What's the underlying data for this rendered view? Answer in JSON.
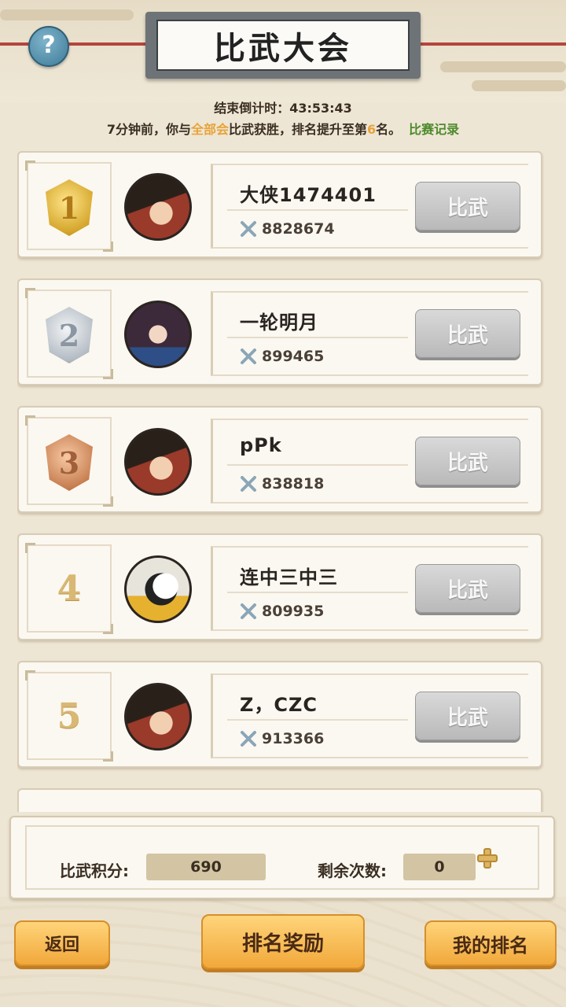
{
  "header": {
    "title": "比武大会",
    "help_glyph": "?"
  },
  "countdown": {
    "label": "结束倒计时：",
    "time": "43:53:43"
  },
  "news": {
    "prefix": "7分钟前，你与",
    "opponent": "全部会",
    "middle": "比武获胜，排名提升至第",
    "rank": "6",
    "suffix": "名。",
    "record_link": "比赛记录"
  },
  "colors": {
    "highlight": "#e8a33a",
    "link": "#4d8a2d",
    "button_orange": "#f1a83a",
    "button_gray": "#b9b9b9"
  },
  "players": [
    {
      "rank": "1",
      "medal": "gold",
      "avatar": "swordsman-portrait",
      "name": "大侠1474401",
      "power": "8828674",
      "button": "比武"
    },
    {
      "rank": "2",
      "medal": "silver",
      "avatar": "lady-portrait",
      "name": "一轮明月",
      "power": "899465",
      "button": "比武"
    },
    {
      "rank": "3",
      "medal": "bronze",
      "avatar": "swordsman-portrait",
      "name": "pPk",
      "power": "838818",
      "button": "比武"
    },
    {
      "rank": "4",
      "medal": "",
      "avatar": "panda-portrait",
      "name": "连中三中三",
      "power": "809935",
      "button": "比武"
    },
    {
      "rank": "5",
      "medal": "",
      "avatar": "swordsman-portrait",
      "name": "Z，CZC",
      "power": "913366",
      "button": "比武"
    }
  ],
  "stats": {
    "score_label": "比武积分:",
    "score_value": "690",
    "remaining_label": "剩余次数:",
    "remaining_value": "0"
  },
  "footer": {
    "back": "返回",
    "rewards": "排名奖励",
    "my_rank": "我的排名"
  }
}
